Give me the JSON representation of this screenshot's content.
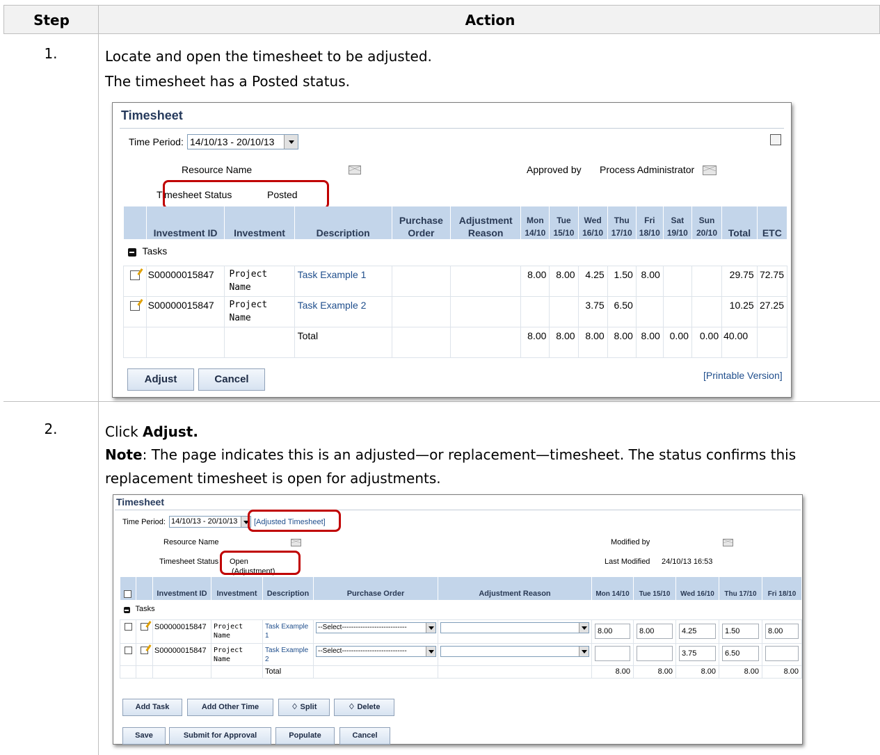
{
  "table": {
    "col_step": "Step",
    "col_action": "Action"
  },
  "step1": {
    "number": "1.",
    "line1": "Locate and open the timesheet to be adjusted.",
    "line2": "The timesheet has a Posted status.",
    "screen": {
      "title": "Timesheet",
      "time_period_label": "Time Period:",
      "time_period_value": "14/10/13 - 20/10/13",
      "resource_name_label": "Resource Name",
      "approved_by_label": "Approved by",
      "approved_by_value": "Process Administrator",
      "status_label": "Timesheet Status",
      "status_value": "Posted",
      "headers": {
        "inv_id": "Investment ID",
        "investment": "Investment",
        "description": "Description",
        "po": "Purchase Order",
        "adj": "Adjustment Reason",
        "mon": "Mon 14/10",
        "tue": "Tue 15/10",
        "wed": "Wed 16/10",
        "thu": "Thu 17/10",
        "fri": "Fri 18/10",
        "sat": "Sat 19/10",
        "sun": "Sun 20/10",
        "total": "Total",
        "etc": "ETC"
      },
      "tasks_label": "Tasks",
      "rows": [
        {
          "id": "S00000015847",
          "investment": "Project Name",
          "description": "Task Example 1",
          "mon": "8.00",
          "tue": "8.00",
          "wed": "4.25",
          "thu": "1.50",
          "fri": "8.00",
          "sat": "",
          "sun": "",
          "total": "29.75",
          "etc": "72.75"
        },
        {
          "id": "S00000015847",
          "investment": "Project Name",
          "description": "Task Example 2",
          "mon": "",
          "tue": "",
          "wed": "3.75",
          "thu": "6.50",
          "fri": "",
          "sat": "",
          "sun": "",
          "total": "10.25",
          "etc": "27.25"
        }
      ],
      "total_row": {
        "label": "Total",
        "mon": "8.00",
        "tue": "8.00",
        "wed": "8.00",
        "thu": "8.00",
        "fri": "8.00",
        "sat": "0.00",
        "sun": "0.00",
        "total": "40.00"
      },
      "adjust_button": "Adjust",
      "cancel_button": "Cancel",
      "printable_link": "[Printable Version]"
    }
  },
  "step2": {
    "number": "2.",
    "click_prefix": "Click ",
    "click_bold": "Adjust.",
    "note_bold": "Note",
    "note_line1": ": The page indicates this is an adjusted—or replacement—timesheet. The status confirms this",
    "note_line2": "replacement timesheet is open for adjustments.",
    "screen": {
      "title": "Timesheet",
      "time_period_label": "Time Period:",
      "time_period_value": "14/10/13 - 20/10/13",
      "adjusted_link": "[Adjusted Timesheet]",
      "resource_name_label": "Resource Name",
      "modified_by_label": "Modified by",
      "status_label": "Timesheet Status",
      "status_value_1": "Open",
      "status_value_2": "(Adjustment)",
      "last_modified_label": "Last Modified",
      "last_modified_value": "24/10/13 16:53",
      "headers": {
        "inv_id": "Investment ID",
        "investment": "Investment",
        "description": "Description",
        "po": "Purchase Order",
        "adj": "Adjustment Reason",
        "mon": "Mon 14/10",
        "tue": "Tue 15/10",
        "wed": "Wed 16/10",
        "thu": "Thu 17/10",
        "fri": "Fri 18/10"
      },
      "tasks_label": "Tasks",
      "select_placeholder": "--Select----------------------------",
      "rows": [
        {
          "id": "S00000015847",
          "investment": "Project Name",
          "description": "Task Example 1",
          "mon": "8.00",
          "tue": "8.00",
          "wed": "4.25",
          "thu": "1.50",
          "fri": "8.00"
        },
        {
          "id": "S00000015847",
          "investment": "Project Name",
          "description": "Task Example 2",
          "mon": "",
          "tue": "",
          "wed": "3.75",
          "thu": "6.50",
          "fri": ""
        }
      ],
      "total_row": {
        "label": "Total",
        "mon": "8.00",
        "tue": "8.00",
        "wed": "8.00",
        "thu": "8.00",
        "fri": "8.00"
      },
      "buttons_row1": {
        "add_task": "Add Task",
        "add_other": "Add Other Time",
        "split": "Split",
        "delete": "Delete"
      },
      "buttons_row2": {
        "save": "Save",
        "submit": "Submit for Approval",
        "populate": "Populate",
        "cancel": "Cancel"
      }
    }
  },
  "colors": {
    "highlight_box": "#c00000",
    "grid_header_bg": "#c3d5ea",
    "link": "#1f4e8c",
    "title": "#263a5c"
  }
}
